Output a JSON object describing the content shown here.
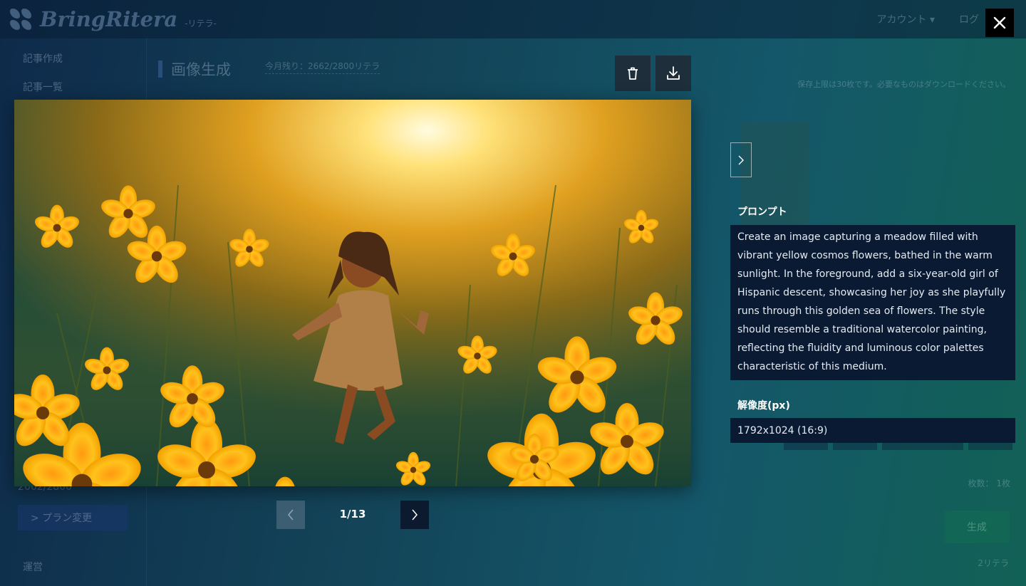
{
  "app": {
    "logo_text": "BringRitera",
    "logo_sub": "-リテラ-",
    "account_menu": "アカウント ▾",
    "logout": "ログ"
  },
  "sidebar": {
    "items": [
      {
        "label": "記事作成"
      },
      {
        "label": "記事一覧"
      },
      {
        "label": "運営"
      }
    ],
    "usage_text": "2662/2800",
    "plan_button": "> プラン変更"
  },
  "page": {
    "title": "画像生成",
    "usage": "今月残り：2662/2800リテラ",
    "storage_note": "保存上限は30枚です。必要なものはダウンロードください。",
    "count_select": "枚数： 1枚",
    "generate_button": "生成",
    "generate_cost": "2リテラ"
  },
  "modal": {
    "close_icon": "close-icon",
    "delete_icon": "trash-icon",
    "download_icon": "download-icon",
    "image_alt": "girl running through yellow cosmos field",
    "prompt_label": "プロンプト",
    "prompt_text": "Create an image capturing a meadow filled with vibrant yellow cosmos flowers, bathed in the warm sunlight. In the foreground, add a six-year-old girl of Hispanic descent, showcasing her joy as she playfully runs through this golden sea of flowers. The style should resemble a traditional watercolor painting, reflecting the fluidity and luminous color palettes characteristic of this medium.",
    "resolution_label": "解像度(px)",
    "resolution_value": "1792x1024 (16:9)",
    "pager": {
      "current": 1,
      "total": 13,
      "text": "1/13"
    }
  },
  "colors": {
    "overlay_left": "#0e2a4a",
    "overlay_right": "#126155",
    "info_box": "#0a1a33",
    "close_bg": "#000000"
  }
}
